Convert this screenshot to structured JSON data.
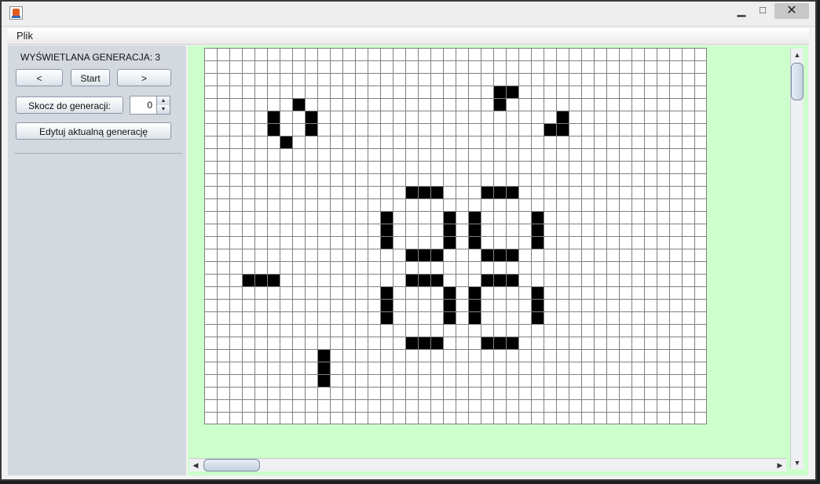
{
  "window": {
    "min_glyph": "▁",
    "max_glyph": "□",
    "close_glyph": "✕"
  },
  "menu": {
    "file": "Plik"
  },
  "panel": {
    "generation_label": "WYŚWIETLANA GENERACJA: 3",
    "prev_label": "<",
    "start_label": "Start",
    "next_label": ">",
    "jump_label": "Skocz do generacji:",
    "jump_value": "0",
    "edit_label": "Edytuj aktualną generację"
  },
  "scroll": {
    "up": "▲",
    "down": "▼",
    "left": "◀",
    "right": "▶"
  },
  "board": {
    "cols": 40,
    "rows": 30,
    "live_color": "#000000",
    "dead_color": "#ffffff",
    "line_color": "#808080",
    "live_cells": [
      [
        23,
        3
      ],
      [
        24,
        3
      ],
      [
        23,
        4
      ],
      [
        28,
        5
      ],
      [
        27,
        6
      ],
      [
        28,
        6
      ],
      [
        7,
        4
      ],
      [
        5,
        5
      ],
      [
        8,
        5
      ],
      [
        5,
        6
      ],
      [
        8,
        6
      ],
      [
        6,
        7
      ],
      [
        16,
        11
      ],
      [
        17,
        11
      ],
      [
        18,
        11
      ],
      [
        22,
        11
      ],
      [
        23,
        11
      ],
      [
        24,
        11
      ],
      [
        14,
        13
      ],
      [
        19,
        13
      ],
      [
        21,
        13
      ],
      [
        26,
        13
      ],
      [
        14,
        14
      ],
      [
        19,
        14
      ],
      [
        21,
        14
      ],
      [
        26,
        14
      ],
      [
        14,
        15
      ],
      [
        19,
        15
      ],
      [
        21,
        15
      ],
      [
        26,
        15
      ],
      [
        16,
        16
      ],
      [
        17,
        16
      ],
      [
        18,
        16
      ],
      [
        22,
        16
      ],
      [
        23,
        16
      ],
      [
        24,
        16
      ],
      [
        3,
        18
      ],
      [
        4,
        18
      ],
      [
        5,
        18
      ],
      [
        16,
        18
      ],
      [
        17,
        18
      ],
      [
        18,
        18
      ],
      [
        22,
        18
      ],
      [
        23,
        18
      ],
      [
        24,
        18
      ],
      [
        14,
        19
      ],
      [
        19,
        19
      ],
      [
        21,
        19
      ],
      [
        26,
        19
      ],
      [
        14,
        20
      ],
      [
        19,
        20
      ],
      [
        21,
        20
      ],
      [
        26,
        20
      ],
      [
        14,
        21
      ],
      [
        19,
        21
      ],
      [
        21,
        21
      ],
      [
        26,
        21
      ],
      [
        16,
        23
      ],
      [
        17,
        23
      ],
      [
        18,
        23
      ],
      [
        22,
        23
      ],
      [
        23,
        23
      ],
      [
        24,
        23
      ],
      [
        9,
        24
      ],
      [
        9,
        25
      ],
      [
        9,
        26
      ]
    ]
  }
}
